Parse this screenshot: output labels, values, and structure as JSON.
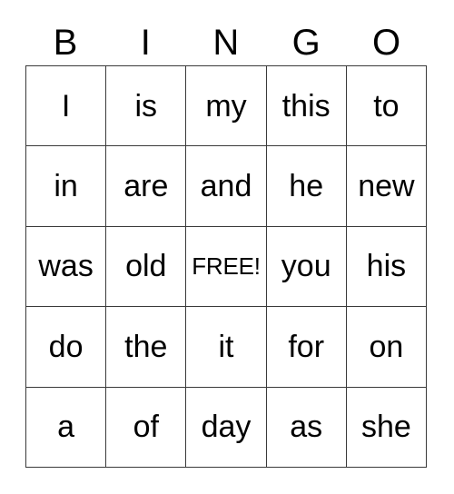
{
  "card": {
    "title": "BINGO",
    "free_space_label": "FREE!",
    "border_color": "#3a3a3a",
    "text_color": "#000000",
    "background_color": "#ffffff",
    "columns": 5,
    "rows": 5
  },
  "header": {
    "letters": [
      "B",
      "I",
      "N",
      "G",
      "O"
    ]
  },
  "grid": {
    "rows": [
      {
        "cells": [
          {
            "text": "I",
            "free": false
          },
          {
            "text": "is",
            "free": false
          },
          {
            "text": "my",
            "free": false
          },
          {
            "text": "this",
            "free": false
          },
          {
            "text": "to",
            "free": false
          }
        ]
      },
      {
        "cells": [
          {
            "text": "in",
            "free": false
          },
          {
            "text": "are",
            "free": false
          },
          {
            "text": "and",
            "free": false
          },
          {
            "text": "he",
            "free": false
          },
          {
            "text": "new",
            "free": false
          }
        ]
      },
      {
        "cells": [
          {
            "text": "was",
            "free": false
          },
          {
            "text": "old",
            "free": false
          },
          {
            "text": "FREE!",
            "free": true
          },
          {
            "text": "you",
            "free": false
          },
          {
            "text": "his",
            "free": false
          }
        ]
      },
      {
        "cells": [
          {
            "text": "do",
            "free": false
          },
          {
            "text": "the",
            "free": false
          },
          {
            "text": "it",
            "free": false
          },
          {
            "text": "for",
            "free": false
          },
          {
            "text": "on",
            "free": false
          }
        ]
      },
      {
        "cells": [
          {
            "text": "a",
            "free": false
          },
          {
            "text": "of",
            "free": false
          },
          {
            "text": "day",
            "free": false
          },
          {
            "text": "as",
            "free": false
          },
          {
            "text": "she",
            "free": false
          }
        ]
      }
    ]
  }
}
